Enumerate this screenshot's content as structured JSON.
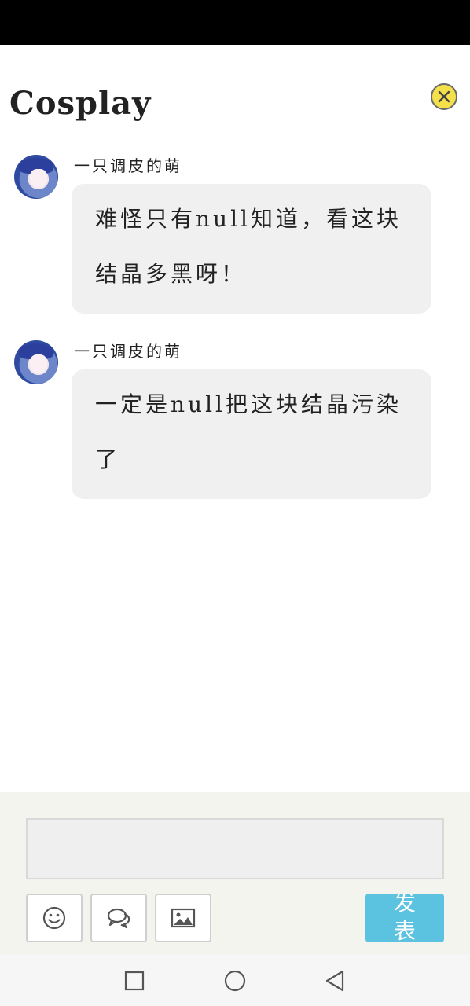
{
  "header": {
    "title": "Cosplay",
    "close_icon": "close-icon"
  },
  "messages": [
    {
      "username": "一只调皮的萌",
      "text": "难怪只有null知道，看这块结晶多黑呀！"
    },
    {
      "username": "一只调皮的萌",
      "text": "一定是null把这块结晶污染了"
    }
  ],
  "compose": {
    "input_value": "",
    "tools": [
      "smiley-icon",
      "chat-bubbles-icon",
      "image-icon"
    ],
    "send_label": "发表"
  },
  "nav": {
    "icons": [
      "square-icon",
      "circle-icon",
      "back-triangle-icon"
    ]
  },
  "colors": {
    "close_button": "#f3e04a",
    "bubble": "#f0f0f0",
    "send_button": "#5bc2df",
    "compose_bg": "#f4f4ef"
  }
}
